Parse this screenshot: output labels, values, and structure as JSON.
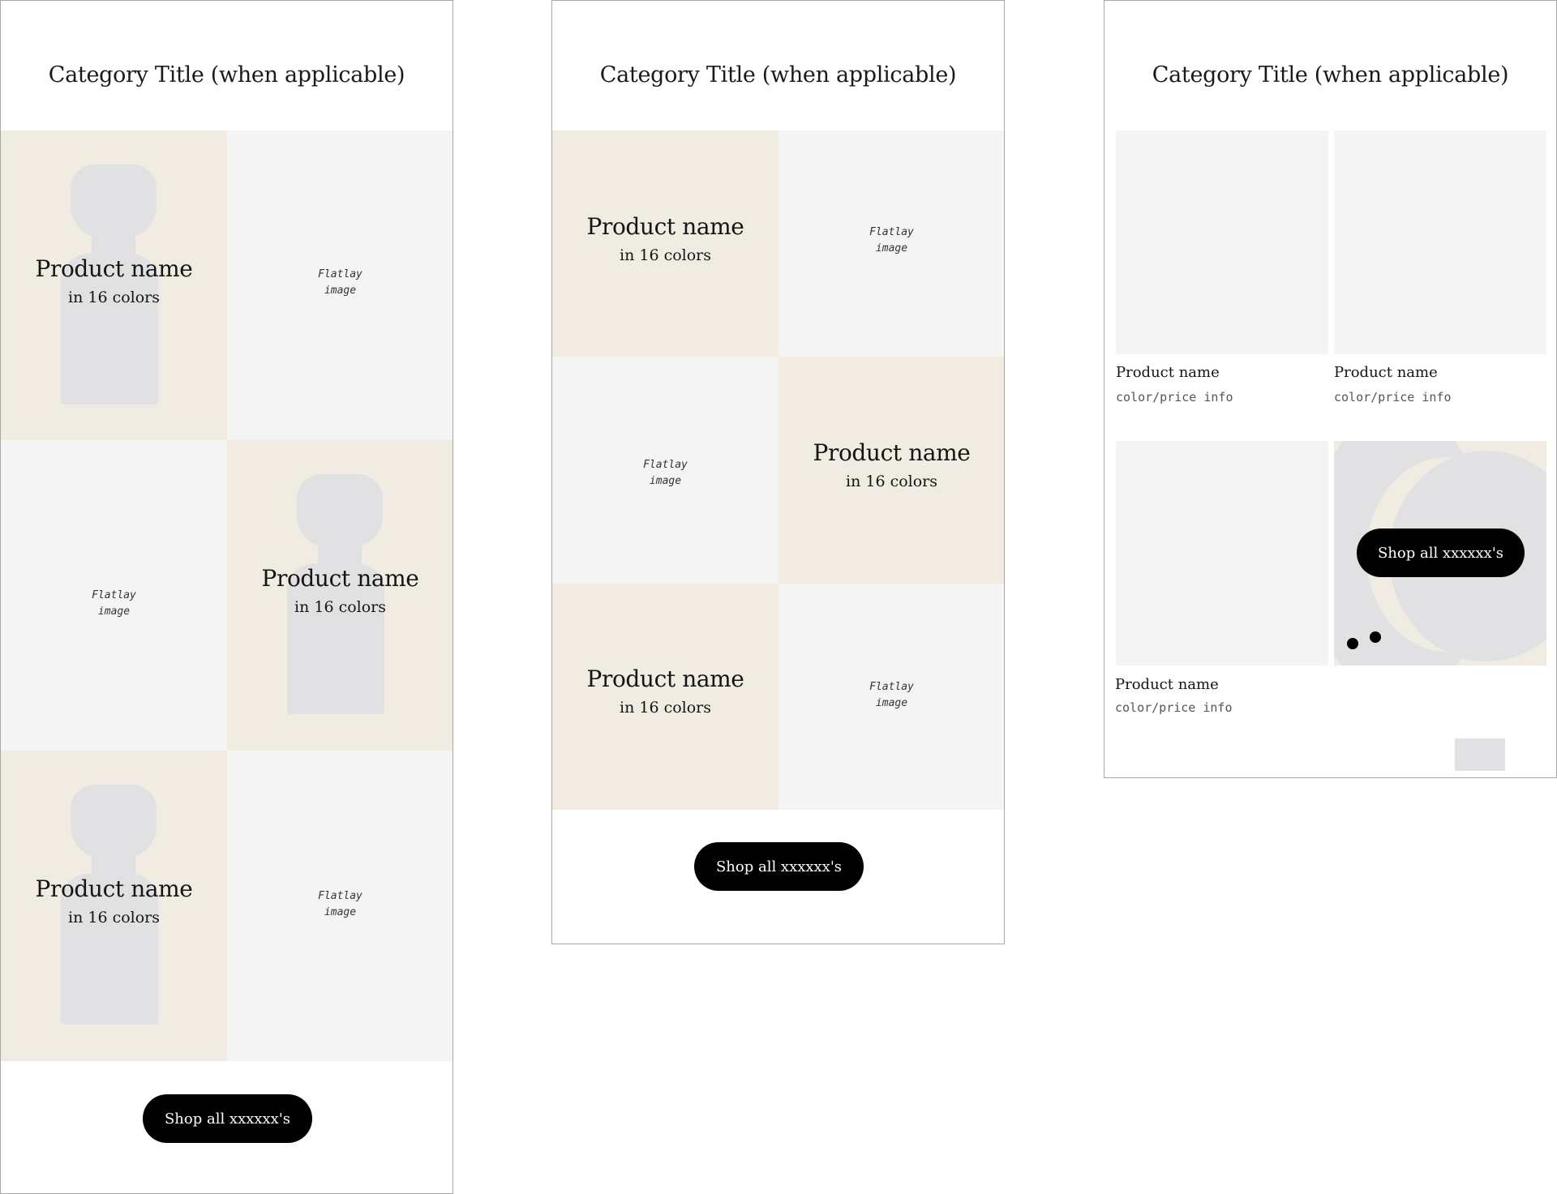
{
  "frames": [
    {
      "category_title": "Category Title (when applicable)",
      "cells": [
        {
          "kind": "product",
          "name": "Product name",
          "colors": "in 16 colors"
        },
        {
          "kind": "flatlay",
          "line1": "Flatlay",
          "line2": "image"
        },
        {
          "kind": "flatlay",
          "line1": "Flatlay",
          "line2": "image"
        },
        {
          "kind": "product",
          "name": "Product name",
          "colors": "in 16 colors"
        },
        {
          "kind": "product",
          "name": "Product name",
          "colors": "in 16 colors"
        },
        {
          "kind": "flatlay",
          "line1": "Flatlay",
          "line2": "image"
        }
      ],
      "shop_button": "Shop all xxxxxx's"
    },
    {
      "category_title": "Category Title (when applicable)",
      "cells": [
        {
          "kind": "product",
          "name": "Product name",
          "colors": "in 16 colors"
        },
        {
          "kind": "flatlay",
          "line1": "Flatlay",
          "line2": "image"
        },
        {
          "kind": "flatlay",
          "line1": "Flatlay",
          "line2": "image"
        },
        {
          "kind": "product",
          "name": "Product name",
          "colors": "in 16 colors"
        },
        {
          "kind": "product",
          "name": "Product name",
          "colors": "in 16 colors"
        },
        {
          "kind": "flatlay",
          "line1": "Flatlay",
          "line2": "image"
        }
      ],
      "shop_button": "Shop all xxxxxx's"
    },
    {
      "category_title": "Category Title (when applicable)",
      "cards": [
        {
          "name": "Product name",
          "info": "color/price info"
        },
        {
          "name": "Product name",
          "info": "color/price info"
        },
        {
          "name": "Product name",
          "info": "color/price info"
        }
      ],
      "shop_button": "Shop all xxxxxx's"
    }
  ],
  "colors": {
    "beige": "#f0ece2",
    "light_grey": "#f4f4f4",
    "silhouette_grey": "#e1e1e3",
    "button_black": "#000000",
    "button_text": "#ffffff"
  },
  "icons": [
    "model-silhouette-icon",
    "decorative-dot-icon"
  ]
}
